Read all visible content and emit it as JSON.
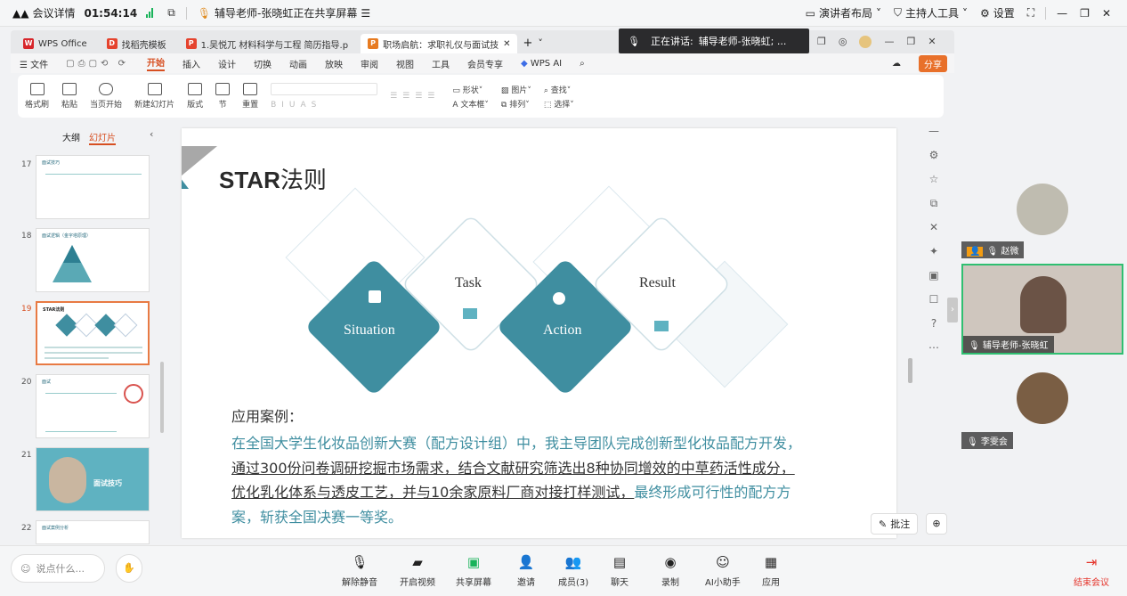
{
  "topbar": {
    "meeting_detail": "会议详情",
    "timer": "01:54:14",
    "sharing_status": "辅导老师-张晓虹正在共享屏幕",
    "layout": "演讲者布局",
    "host_tools": "主持人工具",
    "settings": "设置"
  },
  "tabs": [
    {
      "label": "WPS Office"
    },
    {
      "label": "找稻壳模板"
    },
    {
      "label": "1.吴悦兀 材料科学与工程 简历指导.p"
    },
    {
      "label": "职场启航：求职礼仪与面试技"
    }
  ],
  "speaking": {
    "label": "正在讲话:",
    "name": "辅导老师-张晓虹; ..."
  },
  "menu": {
    "file": "文件",
    "items": [
      "开始",
      "插入",
      "设计",
      "切换",
      "动画",
      "放映",
      "审阅",
      "视图",
      "工具",
      "会员专享"
    ],
    "ai": "WPS AI",
    "share": "分享"
  },
  "ribbon": {
    "items": [
      "格式刷",
      "粘贴",
      "当页开始",
      "新建幻灯片",
      "版式",
      "节",
      "重置"
    ],
    "right": [
      "形状",
      "图片",
      "文本框",
      "排列",
      "查找",
      "选择"
    ]
  },
  "leftpane": {
    "outline": "大纲",
    "slides": "幻灯片"
  },
  "thumbs": [
    {
      "num": "17",
      "title": "面试技巧"
    },
    {
      "num": "18",
      "title": "面试逻辑（金字塔原理）"
    },
    {
      "num": "19",
      "title": "STAR法则"
    },
    {
      "num": "20",
      "title": "面试"
    },
    {
      "num": "21",
      "title": "面试技巧"
    },
    {
      "num": "22",
      "title": "面试案例分析"
    }
  ],
  "slide": {
    "title_bold": "STAR",
    "title_rest": "法则",
    "diamonds": [
      "Situation",
      "Task",
      "Action",
      "Result"
    ],
    "case_heading": "应用案例：",
    "case_text_1": "在全国大学生化妆品创新大赛（配方设计组）中，我主导团队完成创新型化妆品配方开发，",
    "case_text_2": "通过300份问卷调研挖掘市场需求，结合文献研究筛选出8种协同增效的中草药活性成分，",
    "case_text_3": "优化乳化体系与透皮工艺，并与10余家原料厂商对接打样测试，",
    "case_text_4": "最终形成可行性的配方方",
    "case_text_5": "案，斩获全国决赛一等奖。",
    "annotate": "批注"
  },
  "participants": [
    {
      "name": "赵微"
    },
    {
      "name": "辅导老师-张晓虹"
    },
    {
      "name": "李雯会"
    }
  ],
  "bottom": {
    "chat_placeholder": "说点什么...",
    "buttons": [
      "解除静音",
      "开启视频",
      "共享屏幕",
      "邀请",
      "成员(3)",
      "聊天",
      "录制",
      "AI小助手",
      "应用"
    ],
    "end": "结束会议"
  },
  "colors": {
    "accent": "#d74f21",
    "teal": "#3f8ea0",
    "end_red": "#e5352c",
    "video_border": "#2fbf71"
  }
}
